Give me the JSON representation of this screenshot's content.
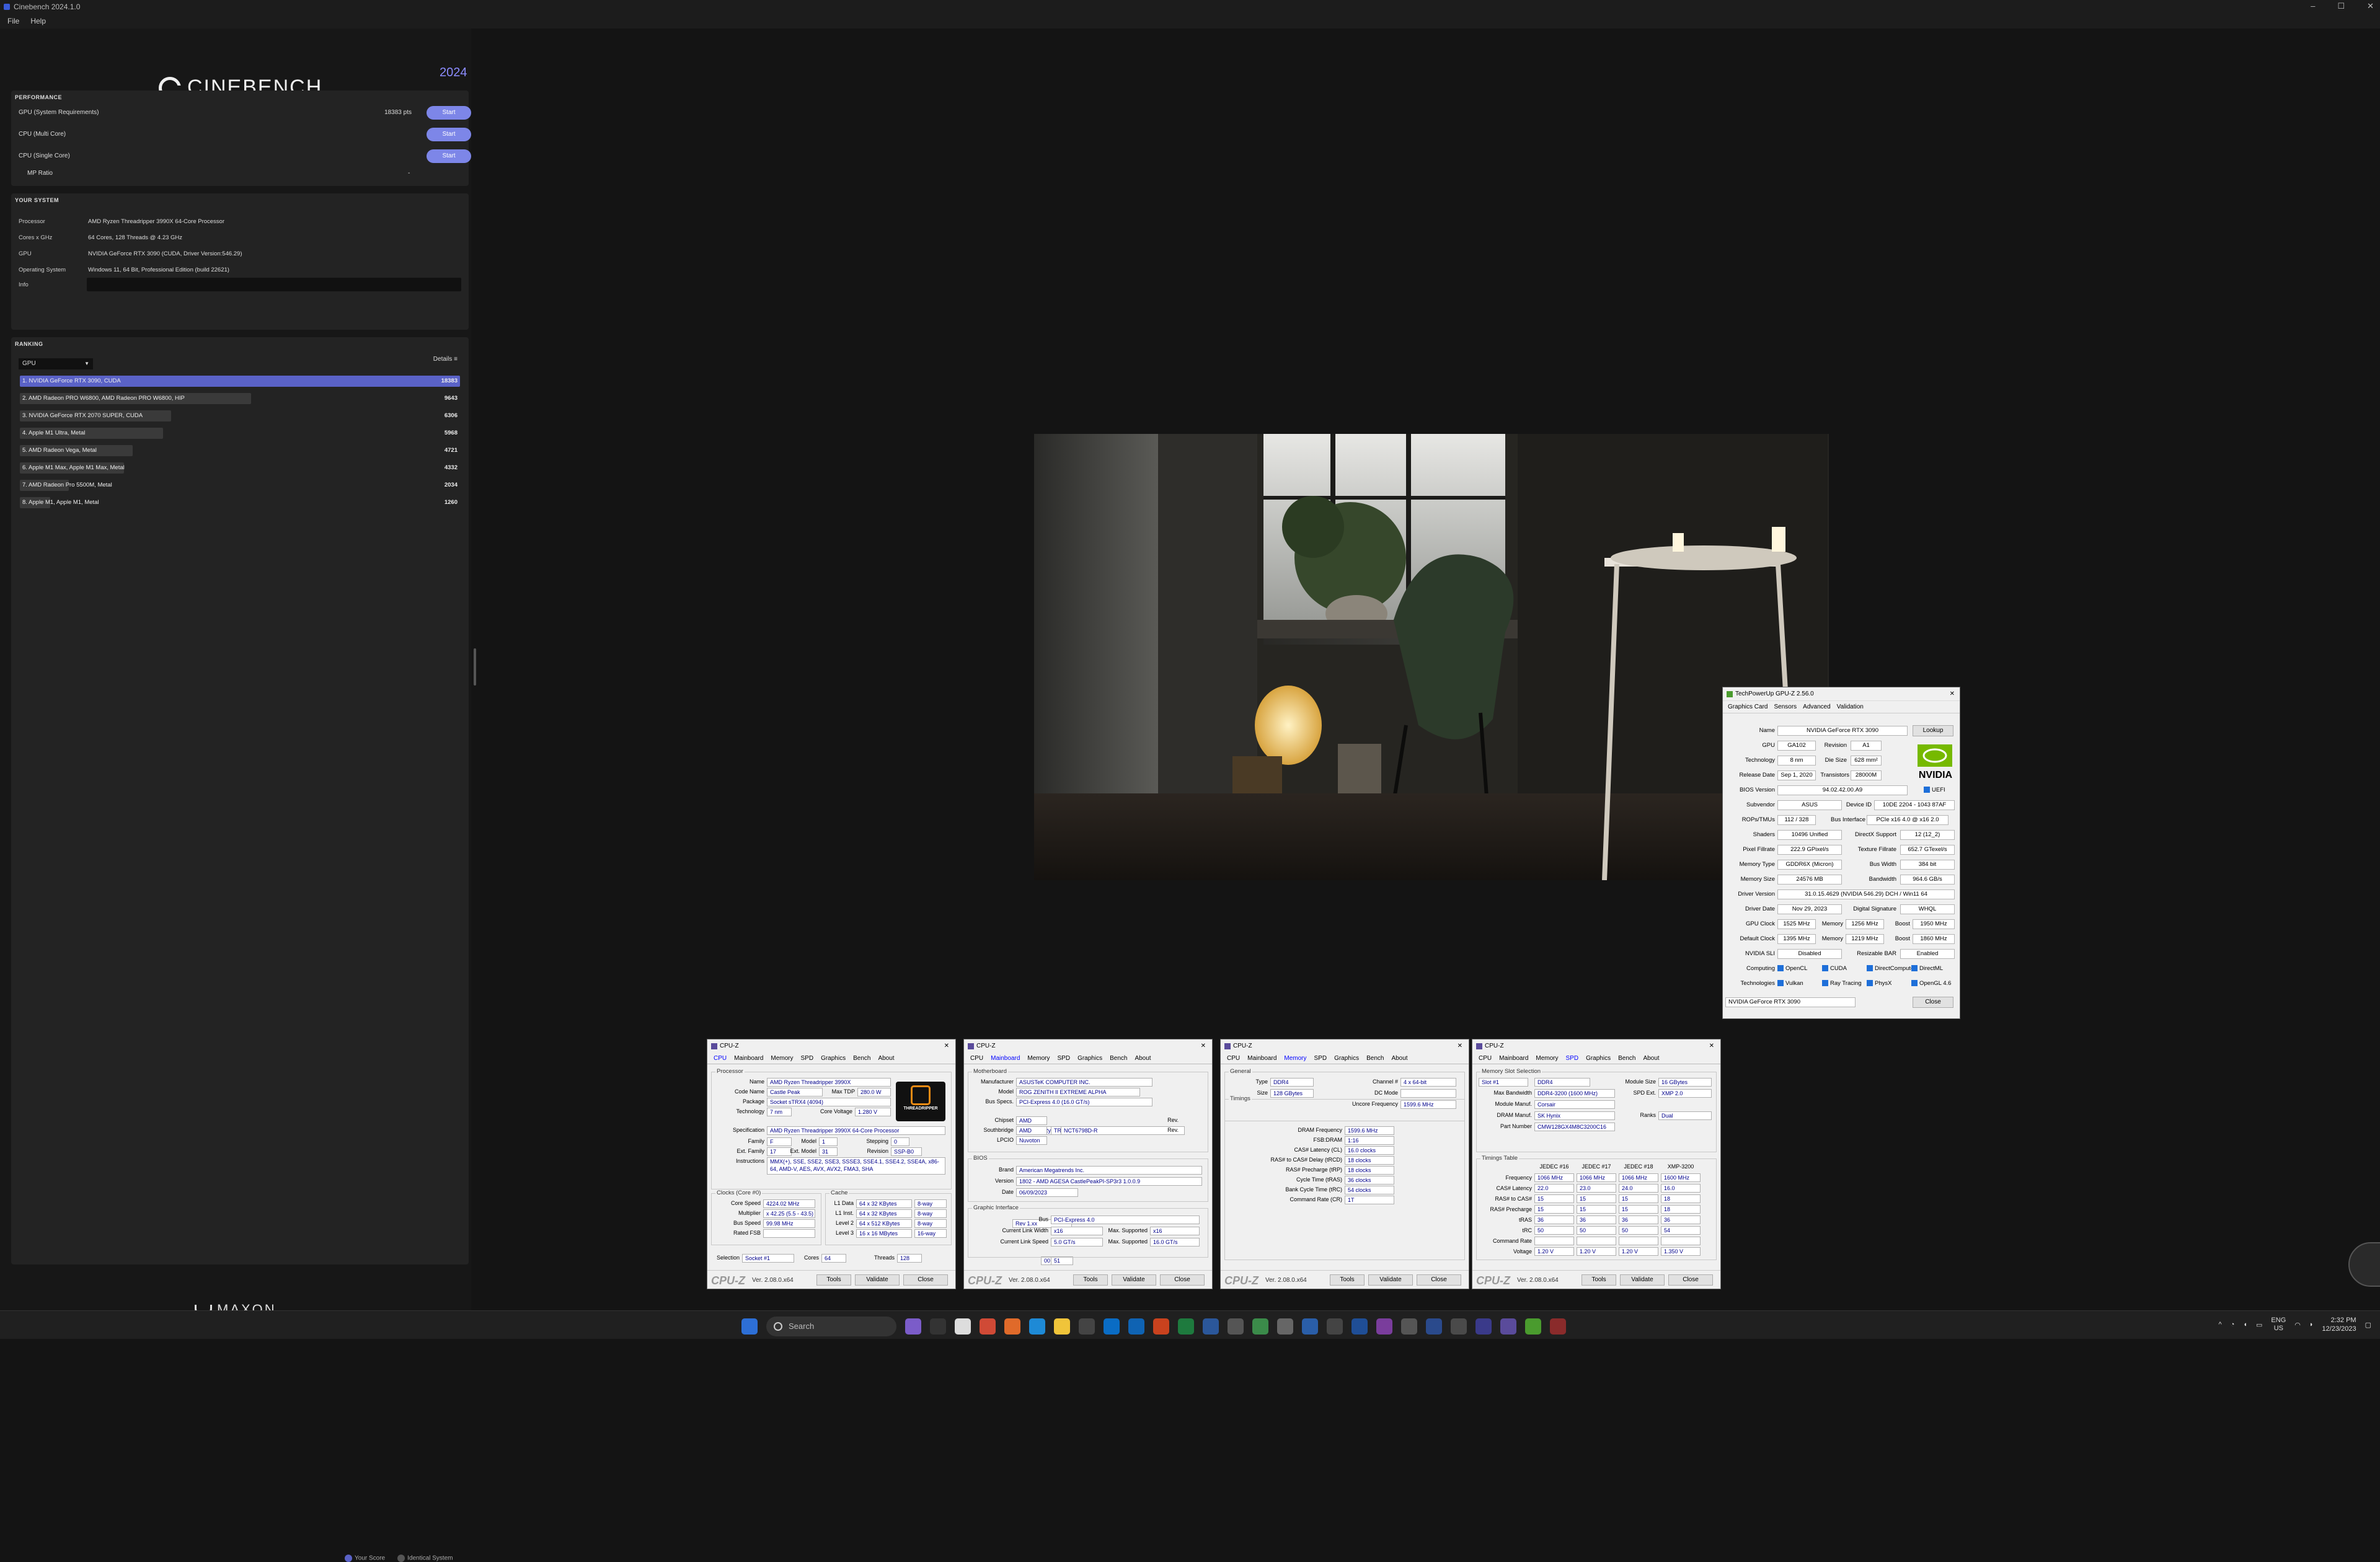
{
  "window": {
    "title": "Cinebench 2024.1.0",
    "menu": [
      "File",
      "Help"
    ]
  },
  "brand": {
    "name": "CINEBENCH",
    "year": "2024",
    "maker": "MAXON"
  },
  "performance": {
    "title": "PERFORMANCE",
    "rows": [
      {
        "label": "GPU (System Requirements)",
        "score": "18383 pts",
        "button": "Start"
      },
      {
        "label": "CPU (Multi Core)",
        "score": "",
        "button": "Start"
      },
      {
        "label": "CPU (Single Core)",
        "score": "",
        "button": "Start"
      }
    ],
    "mp_ratio_label": "MP Ratio",
    "mp_ratio_value": "-"
  },
  "system": {
    "title": "YOUR SYSTEM",
    "rows": [
      {
        "label": "Processor",
        "value": "AMD Ryzen Threadripper 3990X 64-Core Processor"
      },
      {
        "label": "Cores x GHz",
        "value": "64 Cores, 128 Threads @ 4.23 GHz"
      },
      {
        "label": "GPU",
        "value": "NVIDIA GeForce RTX 3090 (CUDA, Driver Version:546.29)"
      },
      {
        "label": "Operating System",
        "value": "Windows 11, 64 Bit, Professional Edition (build 22621)"
      },
      {
        "label": "Info",
        "value": ""
      }
    ]
  },
  "ranking": {
    "title": "RANKING",
    "filter": "GPU",
    "details": "Details",
    "items": [
      {
        "label": "1. NVIDIA GeForce RTX 3090, CUDA",
        "score": "18383",
        "fraction": 1.0,
        "own": true
      },
      {
        "label": "2. AMD Radeon PRO W6800, AMD Radeon PRO W6800, HIP",
        "score": "9643",
        "fraction": 0.525,
        "own": false
      },
      {
        "label": "3. NVIDIA GeForce RTX 2070 SUPER, CUDA",
        "score": "6306",
        "fraction": 0.343,
        "own": false
      },
      {
        "label": "4. Apple M1 Ultra, Metal",
        "score": "5968",
        "fraction": 0.325,
        "own": false
      },
      {
        "label": "5. AMD Radeon Vega, Metal",
        "score": "4721",
        "fraction": 0.257,
        "own": false
      },
      {
        "label": "6. Apple M1 Max, Apple M1 Max, Metal",
        "score": "4332",
        "fraction": 0.236,
        "own": false
      },
      {
        "label": "7. AMD Radeon Pro 5500M, Metal",
        "score": "2034",
        "fraction": 0.111,
        "own": false
      },
      {
        "label": "8. Apple M1, Apple M1, Metal",
        "score": "1260",
        "fraction": 0.069,
        "own": false
      }
    ],
    "legend": [
      "Your Score",
      "Identical System"
    ]
  },
  "gpuz": {
    "title": "TechPowerUp GPU-Z 2.56.0",
    "tabs": [
      "Graphics Card",
      "Sensors",
      "Advanced",
      "Validation"
    ],
    "name": "NVIDIA GeForce RTX 3090",
    "lookup": "Lookup",
    "gpu": "GA102",
    "revision": "A1",
    "technology": "8 nm",
    "die_size": "628 mm²",
    "release_date": "Sep 1, 2020",
    "transistors": "28000M",
    "bios": "94.02.42.00.A9",
    "uefi": "UEFI",
    "subvendor": "ASUS",
    "device_id": "10DE 2204 - 1043 87AF",
    "rops": "112 / 328",
    "bus_interface": "PCIe x16 4.0 @ x16 2.0",
    "shaders": "10496 Unified",
    "directx": "12 (12_2)",
    "pixel_fillrate": "222.9 GPixel/s",
    "texture_fillrate": "652.7 GTexel/s",
    "memory_type": "GDDR6X (Micron)",
    "bus_width": "384 bit",
    "memory_size": "24576 MB",
    "bandwidth": "964.6 GB/s",
    "driver_version": "31.0.15.4629 (NVIDIA 546.29) DCH / Win11 64",
    "driver_date": "Nov 29, 2023",
    "digital_signature": "WHQL",
    "gpu_clock": "1525 MHz",
    "memory_clock": "1256 MHz",
    "boost_clock": "1950 MHz",
    "default_clock": "1395 MHz",
    "default_memory": "1219 MHz",
    "default_boost": "1860 MHz",
    "sli": "Disabled",
    "resizable_bar": "Enabled",
    "computing": [
      "OpenCL",
      "CUDA",
      "DirectCompute",
      "DirectML"
    ],
    "technologies": [
      "Vulkan",
      "Ray Tracing",
      "PhysX",
      "OpenGL 4.6"
    ],
    "select": "NVIDIA GeForce RTX 3090",
    "close": "Close",
    "labels": {
      "name": "Name",
      "gpu": "GPU",
      "revision": "Revision",
      "technology": "Technology",
      "die": "Die Size",
      "release": "Release Date",
      "transistors": "Transistors",
      "bios": "BIOS Version",
      "subvendor": "Subvendor",
      "device": "Device ID",
      "rops": "ROPs/TMUs",
      "bus": "Bus Interface",
      "shaders": "Shaders",
      "directx": "DirectX Support",
      "pixel": "Pixel Fillrate",
      "texture": "Texture Fillrate",
      "memtype": "Memory Type",
      "buswidth": "Bus Width",
      "memsize": "Memory Size",
      "bandwidth": "Bandwidth",
      "driver": "Driver Version",
      "driverdate": "Driver Date",
      "digsig": "Digital Signature",
      "gpuclock": "GPU Clock",
      "memory": "Memory",
      "boost": "Boost",
      "defclock": "Default Clock",
      "sli": "NVIDIA SLI",
      "rebar": "Resizable BAR",
      "computing": "Computing",
      "tech": "Technologies"
    }
  },
  "cpuz_common": {
    "brand": "CPU-Z",
    "version": "Ver. 2.08.0.x64",
    "tools": "Tools",
    "validate": "Validate",
    "close": "Close",
    "title": "CPU-Z"
  },
  "cpuz_cpu": {
    "tabs": [
      "CPU",
      "Mainboard",
      "Memory",
      "SPD",
      "Graphics",
      "Bench",
      "About"
    ],
    "group": "Processor",
    "name": "AMD Ryzen Threadripper 3990X",
    "code_name": "Castle Peak",
    "max_tdp": "280.0 W",
    "package": "Socket sTRX4 (4094)",
    "technology": "7 nm",
    "core_voltage": "1.280 V",
    "specification": "AMD Ryzen Threadripper 3990X 64-Core Processor",
    "family": "F",
    "model": "1",
    "stepping": "0",
    "ext_family": "17",
    "ext_model": "31",
    "revision": "SSP-B0",
    "instructions": "MMX(+), SSE, SSE2, SSE3, SSSE3, SSE4.1, SSE4.2, SSE4A, x86-64, AMD-V, AES, AVX, AVX2, FMA3, SHA",
    "clocks_group": "Clocks (Core #0)",
    "cache_group": "Cache",
    "core_speed": "4224.02 MHz",
    "multiplier": "x 42.25 (5.5 - 43.5)",
    "bus_speed": "99.98 MHz",
    "rated_fsb": "",
    "l1d": "64 x 32 KBytes",
    "l1d_way": "8-way",
    "l1i": "64 x 32 KBytes",
    "l1i_way": "8-way",
    "l2": "64 x 512 KBytes",
    "l2_way": "8-way",
    "l3": "16 x 16 MBytes",
    "l3_way": "16-way",
    "selection": "Socket #1",
    "cores": "64",
    "threads": "128",
    "logo_text": "THREADRIPPER"
  },
  "cpuz_mb": {
    "group": "Motherboard",
    "manufacturer": "ASUSTeK COMPUTER INC.",
    "model": "ROG ZENITH II EXTREME ALPHA",
    "model_rev": "Rev 1.xx",
    "bus_specs": "PCI-Express 4.0 (16.0 GT/s)",
    "chipset": "AMD",
    "chipset_name": "Ryzen SOC",
    "chipset_rev": "00",
    "southbridge": "AMD",
    "southbridge_name": "TRX40",
    "southbridge_rev": "51",
    "lpcio": "Nuvoton",
    "lpcio_name": "NCT6798D-R",
    "bios_group": "BIOS",
    "brand": "American Megatrends Inc.",
    "version": "1802 - AMD AGESA CastlePeakPI-SP3r3 1.0.0.9",
    "date": "06/09/2023",
    "gi_group": "Graphic Interface",
    "gi_bus": "PCI-Express 4.0",
    "link_width": "x16",
    "max_width": "x16",
    "link_speed": "5.0 GT/s",
    "max_speed": "16.0 GT/s"
  },
  "cpuz_mem": {
    "general_group": "General",
    "type": "DDR4",
    "channel": "4 x 64-bit",
    "size": "128 GBytes",
    "dc_mode": "",
    "uncore_freq": "1599.6 MHz",
    "timings_group": "Timings",
    "dram_freq": "1599.6 MHz",
    "fsb_dram": "1:16",
    "cas": "16.0 clocks",
    "trcd": "18 clocks",
    "trp": "18 clocks",
    "tras": "36 clocks",
    "trc": "54 clocks",
    "cr": "1T"
  },
  "cpuz_spd": {
    "slot_group": "Memory Slot Selection",
    "slot": "Slot #1",
    "type": "DDR4",
    "module_size": "16 GBytes",
    "max_bw": "DDR4-3200 (1600 MHz)",
    "spd_ext": "XMP 2.0",
    "manufacturer": "Corsair",
    "dram_manuf": "SK Hynix",
    "ranks": "Dual",
    "part_number": "CMW128GX4M8C3200C16",
    "timings_group": "Timings Table",
    "cols": [
      "JEDEC #16",
      "JEDEC #17",
      "JEDEC #18",
      "XMP-3200"
    ],
    "rows": [
      {
        "label": "Frequency",
        "values": [
          "1066 MHz",
          "1066 MHz",
          "1066 MHz",
          "1600 MHz"
        ]
      },
      {
        "label": "CAS# Latency",
        "values": [
          "22.0",
          "23.0",
          "24.0",
          "16.0"
        ]
      },
      {
        "label": "RAS# to CAS#",
        "values": [
          "15",
          "15",
          "15",
          "18"
        ]
      },
      {
        "label": "RAS# Precharge",
        "values": [
          "15",
          "15",
          "15",
          "18"
        ]
      },
      {
        "label": "tRAS",
        "values": [
          "36",
          "36",
          "36",
          "36"
        ]
      },
      {
        "label": "tRC",
        "values": [
          "50",
          "50",
          "50",
          "54"
        ]
      },
      {
        "label": "Command Rate",
        "values": [
          "",
          "",
          "",
          ""
        ]
      },
      {
        "label": "Voltage",
        "values": [
          "1.20 V",
          "1.20 V",
          "1.20 V",
          "1.350 V"
        ]
      }
    ]
  },
  "taskbar": {
    "search": "Search",
    "lang": "ENG",
    "region": "US",
    "time": "2:32 PM",
    "date": "12/23/2023"
  }
}
